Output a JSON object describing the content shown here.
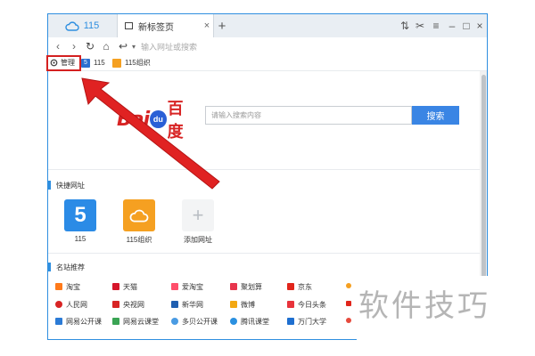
{
  "colors": {
    "accent": "#2f8fe0",
    "annotation": "#d42020",
    "baidu_red": "#d82424",
    "search_button": "#3a85e4"
  },
  "tabs": {
    "cloud_label": "115",
    "active_title": "新标签页",
    "close_glyph": "×",
    "new_glyph": "+"
  },
  "window_controls": {
    "sort": "⇅",
    "cut": "✂",
    "menu": "≡",
    "minimize": "–",
    "maximize": "□",
    "close": "×"
  },
  "toolbar": {
    "back": "‹",
    "forward": "›",
    "refresh": "↻",
    "home": "⌂",
    "undo": "↩",
    "dropdown": "▾",
    "address_placeholder": "输入网址或搜索"
  },
  "bookmarks": [
    {
      "label": "管理",
      "icon": "gear-icon"
    },
    {
      "label": "115",
      "icon": "115-icon"
    },
    {
      "label": "115组织",
      "icon": "cloud-org-icon"
    }
  ],
  "search": {
    "logo_text": "Bai",
    "logo_paw": "du",
    "logo_cn": "百度",
    "placeholder": "请输入搜索内容",
    "button": "搜索"
  },
  "quick_links": {
    "title": "快捷网址",
    "items": [
      {
        "label": "115",
        "glyph": "5",
        "color": "#2b8be6"
      },
      {
        "label": "115组织",
        "glyph": "☁",
        "color": "#f5a021"
      },
      {
        "label": "添加网址",
        "glyph": "+",
        "color": "#f3f4f5"
      }
    ]
  },
  "sites": {
    "title": "名站推荐",
    "rows": [
      [
        {
          "label": "淘宝",
          "color": "#ff7a1a"
        },
        {
          "label": "天猫",
          "color": "#d6162a"
        },
        {
          "label": "爱淘宝",
          "color": "#ff4e6a"
        },
        {
          "label": "聚划算",
          "color": "#e8354d"
        },
        {
          "label": "京东",
          "color": "#e1251b"
        }
      ],
      [
        {
          "label": "人民网",
          "color": "#d82424"
        },
        {
          "label": "央视网",
          "color": "#d82424"
        },
        {
          "label": "新华网",
          "color": "#1f5fb0"
        },
        {
          "label": "微博",
          "color": "#f3a812"
        },
        {
          "label": "今日头条",
          "color": "#e8333b"
        }
      ],
      [
        {
          "label": "网易公开课",
          "color": "#2b7bd6"
        },
        {
          "label": "网易云课堂",
          "color": "#3aa454"
        },
        {
          "label": "多贝公开课",
          "color": "#4a9be3"
        },
        {
          "label": "腾讯课堂",
          "color": "#2a90e0"
        },
        {
          "label": "万门大学",
          "color": "#1e6fd0"
        }
      ]
    ]
  },
  "watermark": "软件技巧"
}
